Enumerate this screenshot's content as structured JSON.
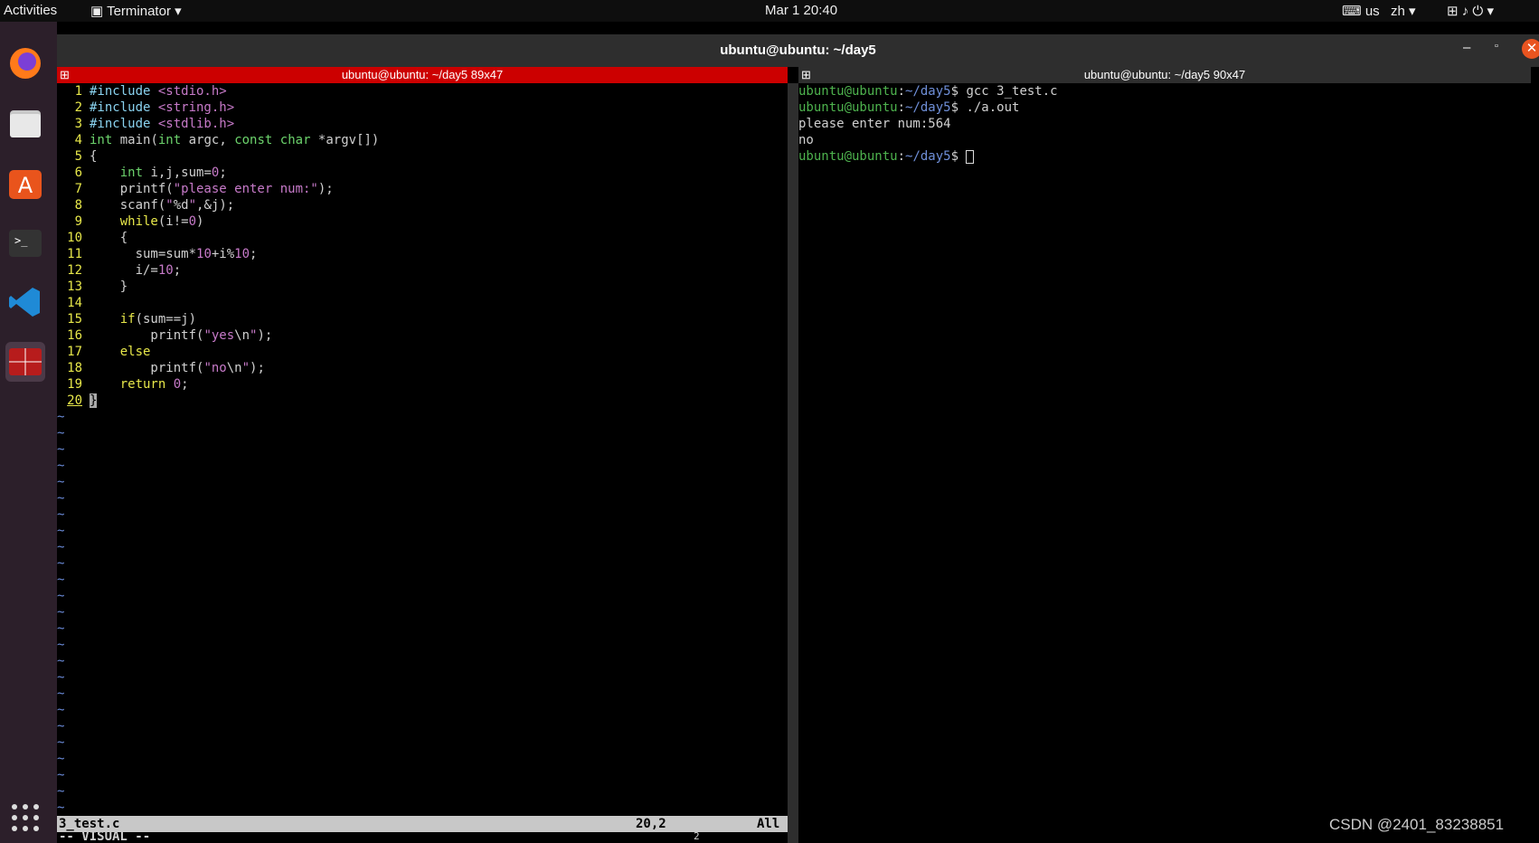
{
  "topbar": {
    "activities": "Activities",
    "app": "Terminator",
    "clock": "Mar 1  20:40",
    "kbd": "us",
    "lang": "zh"
  },
  "window": {
    "title": "ubuntu@ubuntu: ~/day5"
  },
  "left_pane": {
    "header": "ubuntu@ubuntu: ~/day5 89x47",
    "status_file": "3_test.c",
    "status_pos": "20,2",
    "status_all": "All",
    "mode": "-- VISUAL --",
    "count": "2",
    "lines": [
      "#include <stdio.h>",
      "#include <string.h>",
      "#include <stdlib.h>",
      "int main(int argc, const char *argv[])",
      "{",
      "    int i,j,sum=0;",
      "    printf(\"please enter num:\");",
      "    scanf(\"%d\",&j);",
      "    while(i!=0)",
      "    {",
      "      sum=sum*10+i%10;",
      "      i/=10;",
      "    }",
      "",
      "    if(sum==j)",
      "        printf(\"yes\\n\");",
      "    else",
      "        printf(\"no\\n\");",
      "    return 0;",
      "}"
    ]
  },
  "right_pane": {
    "header": "ubuntu@ubuntu: ~/day5 90x47",
    "prompt_user": "ubuntu@ubuntu",
    "prompt_path": "~/day5",
    "cmd1": "gcc 3_test.c",
    "cmd2": "./a.out",
    "out1": "please enter num:564",
    "out2": "no"
  },
  "watermark": "CSDN @2401_83238851",
  "colors": {
    "active_header": "#cc0000",
    "inactive_header": "#2e2e2e",
    "dock": "#2c1f2a"
  }
}
